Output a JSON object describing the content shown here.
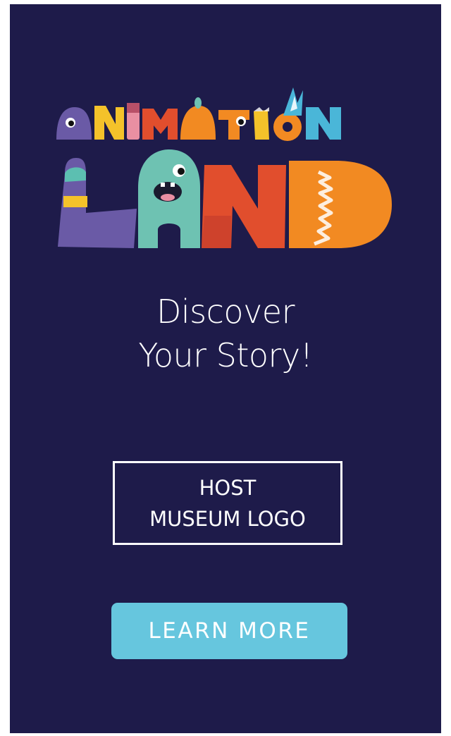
{
  "logo": {
    "name": "ANIMATION LAND",
    "colors": {
      "purple": "#6a5aa6",
      "yellow": "#f4c22a",
      "red": "#e14e2d",
      "orange": "#f28a22",
      "teal": "#6ec2b2",
      "blue": "#4ab6d8",
      "pink": "#e98fa2"
    }
  },
  "tagline": {
    "line1": "Discover",
    "line2": "Your Story!"
  },
  "host_logo": {
    "line1": "HOST",
    "line2": "MUSEUM LOGO"
  },
  "cta": {
    "label": "LEARN MORE"
  },
  "colors": {
    "background": "#1e1b4a",
    "button": "#66c6de",
    "text": "#ffffff"
  }
}
